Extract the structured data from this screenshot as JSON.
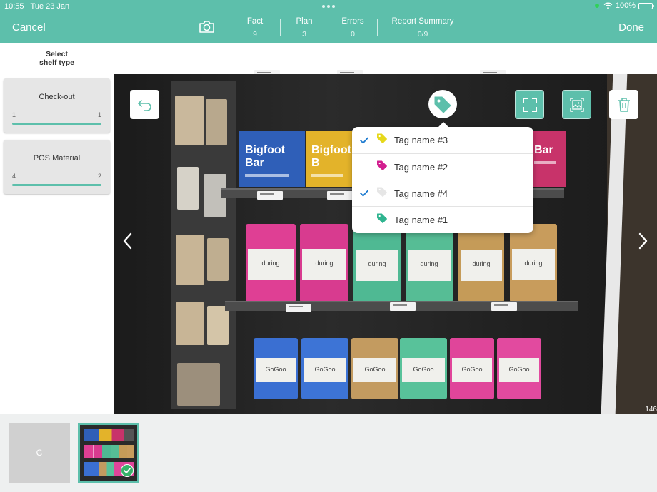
{
  "status": {
    "time": "10:55",
    "date": "Tue 23 Jan",
    "battery": "100%",
    "battery_level": 1.0
  },
  "header": {
    "cancel_label": "Cancel",
    "done_label": "Done",
    "stats": [
      {
        "label": "Fact",
        "value": "9"
      },
      {
        "label": "Plan",
        "value": "3"
      },
      {
        "label": "Errors",
        "value": "0"
      },
      {
        "label": "Report Summary",
        "value": "0/9"
      }
    ]
  },
  "sidebar": {
    "title_line1": "Select",
    "title_line2": "shelf type",
    "cards": [
      {
        "label": "Check-out",
        "left": "1",
        "right": "1",
        "progress": 1.0
      },
      {
        "label": "POS Material",
        "left": "4",
        "right": "2",
        "progress": 1.0
      }
    ]
  },
  "photo": {
    "brand_texts": [
      "Bigfoot Bar",
      "Bigfoot B",
      "Bar"
    ],
    "pouch_text": "during",
    "pouch_text_bottom": "GoGoo",
    "zoom_text": "146"
  },
  "tag_dropdown": {
    "items": [
      {
        "label": "Tag name #3",
        "checked": true,
        "color": "#e6d81a"
      },
      {
        "label": "Tag name #2",
        "checked": false,
        "color": "#d21e8f"
      },
      {
        "label": "Tag name #4",
        "checked": true,
        "color": "#e6e6e6"
      },
      {
        "label": "Tag name #1",
        "checked": false,
        "color": "#2fb48f"
      }
    ]
  },
  "thumbnails": {
    "empty_label": "C"
  },
  "colors": {
    "accent": "#5dbfab",
    "check_blue": "#1e7bd0",
    "success": "#38b36a"
  },
  "icons": [
    "camera-icon",
    "undo-icon",
    "tag-icon",
    "fullscreen-icon",
    "crop-image-icon",
    "trash-icon",
    "chevron-left-icon",
    "chevron-right-icon",
    "checkmark-icon",
    "wifi-icon",
    "battery-icon"
  ]
}
